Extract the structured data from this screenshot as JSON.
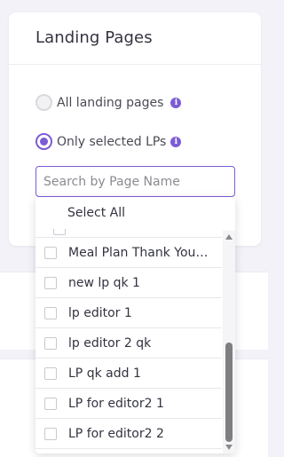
{
  "card": {
    "title": "Landing Pages"
  },
  "radios": {
    "all_label": "All landing pages",
    "selected_label": "Only selected LPs",
    "selected": "selected"
  },
  "search": {
    "placeholder": "Search by Page Name",
    "value": ""
  },
  "dropdown": {
    "select_all_label": "Select All",
    "items": [
      {
        "label": "Meal Plan Thank You A...",
        "checked": false
      },
      {
        "label": "new lp qk 1",
        "checked": false
      },
      {
        "label": "lp editor 1",
        "checked": false
      },
      {
        "label": "lp editor 2 qk",
        "checked": false
      },
      {
        "label": "LP qk add 1",
        "checked": false
      },
      {
        "label": "LP for editor2 1",
        "checked": false
      },
      {
        "label": "LP for editor2 2",
        "checked": false
      }
    ]
  },
  "colors": {
    "accent": "#7c5cd6",
    "background": "#f3f2f8"
  },
  "icons": {
    "info": "info-icon",
    "radio": "radio-button"
  }
}
